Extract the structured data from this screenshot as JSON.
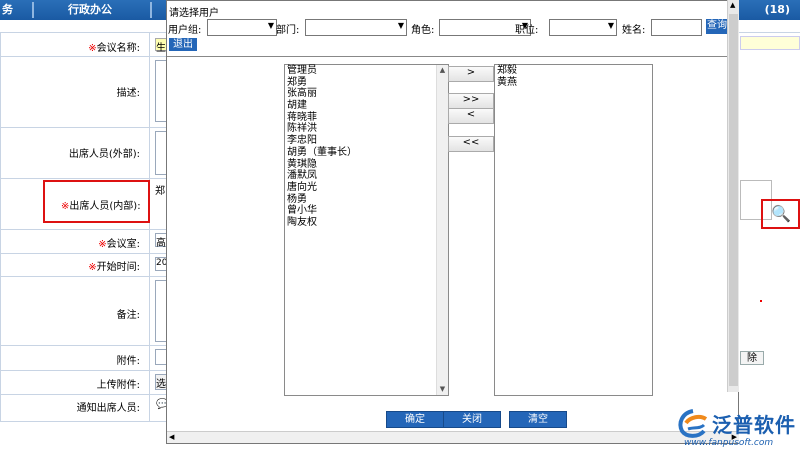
{
  "topnav": {
    "left_fragment": "务",
    "tab": "行政办公",
    "right_text": "(18)"
  },
  "form": {
    "rows": [
      {
        "label": "会议名称:",
        "required": true
      },
      {
        "label": "描述:",
        "required": false
      },
      {
        "label": "出席人员(外部):",
        "required": false
      },
      {
        "label": "出席人员(内部):",
        "required": true
      },
      {
        "label": "会议室:",
        "required": true
      },
      {
        "label": "开始时间:",
        "required": true
      },
      {
        "label": "备注:",
        "required": false
      },
      {
        "label": "附件:",
        "required": false
      },
      {
        "label": "上传附件:",
        "required": false
      },
      {
        "label": "通知出席人员:",
        "required": false
      }
    ],
    "value_fragments": {
      "name": "生",
      "internal": "郑",
      "room": "高",
      "start": "20",
      "upload": "选"
    },
    "remove_button": "除",
    "req_mark": "※"
  },
  "dialog": {
    "title": "请选择用户",
    "filters": {
      "user_group": "用户组:",
      "dept": "部门:",
      "role": "角色:",
      "position": "职位:",
      "name": "姓名:",
      "query": "查询"
    },
    "exit": "退出",
    "available_users": [
      "管理员",
      "郑勇",
      "张高丽",
      "胡建",
      "蒋晓菲",
      "陈祥洪",
      "李忠阳",
      "胡勇（董事长）",
      "黄琪隐",
      "潘默凤",
      "唐向光",
      "杨勇",
      "曾小华",
      "陶友权"
    ],
    "selected_users": [
      "郑毅",
      "黄燕"
    ],
    "move": {
      "add": ">",
      "add_all": ">>",
      "remove": "<",
      "remove_all": "<<"
    },
    "buttons": {
      "ok": "确定",
      "close": "关闭",
      "clear": "清空"
    }
  },
  "logo": {
    "brand": "泛普软件",
    "url": "www.fanpusoft.com"
  },
  "colors": {
    "nav": "#1f64ad",
    "button": "#2466b8",
    "required": "#ee0000",
    "highlight": "#d11111"
  }
}
